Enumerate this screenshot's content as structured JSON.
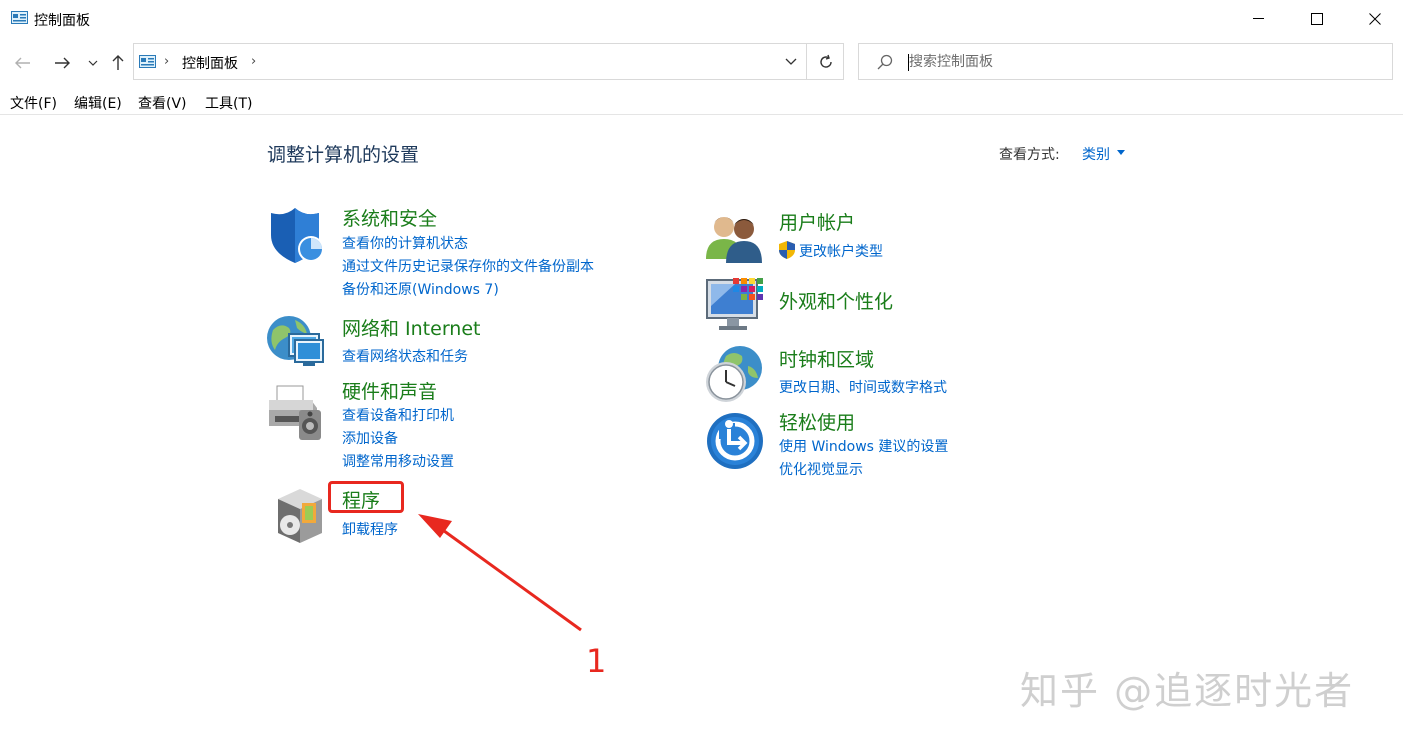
{
  "window": {
    "title": "控制面板"
  },
  "address": {
    "crumb": "控制面板",
    "separator": "›"
  },
  "search": {
    "placeholder": "搜索控制面板"
  },
  "menu": [
    "文件(F)",
    "编辑(E)",
    "查看(V)",
    "工具(T)"
  ],
  "heading": "调整计算机的设置",
  "view_by": {
    "label": "查看方式:",
    "value": "类别"
  },
  "categories": {
    "system_security": {
      "title": "系统和安全",
      "links": [
        "查看你的计算机状态",
        "通过文件历史记录保存你的文件备份副本",
        "备份和还原(Windows 7)"
      ],
      "icon": "shield-icon"
    },
    "network": {
      "title": "网络和 Internet",
      "links": [
        "查看网络状态和任务"
      ],
      "icon": "network-icon"
    },
    "hardware": {
      "title": "硬件和声音",
      "links": [
        "查看设备和打印机",
        "添加设备",
        "调整常用移动设置"
      ],
      "icon": "printer-icon"
    },
    "programs": {
      "title": "程序",
      "links": [
        "卸载程序"
      ],
      "icon": "programs-icon"
    },
    "user_accounts": {
      "title": "用户帐户",
      "links": [
        "更改帐户类型"
      ],
      "icon": "users-icon"
    },
    "appearance": {
      "title": "外观和个性化",
      "links": [],
      "icon": "monitor-icon"
    },
    "clock": {
      "title": "时钟和区域",
      "links": [
        "更改日期、时间或数字格式"
      ],
      "icon": "clock-icon"
    },
    "ease": {
      "title": "轻松使用",
      "links": [
        "使用 Windows 建议的设置",
        "优化视觉显示"
      ],
      "icon": "ease-of-access-icon"
    }
  },
  "annotation": {
    "step": "1",
    "color": "#e8281f"
  },
  "watermark": "知乎 @追逐时光者",
  "colors": {
    "category_title": "#1a7d1a",
    "link": "#0066cc",
    "heading": "#1e395b"
  }
}
